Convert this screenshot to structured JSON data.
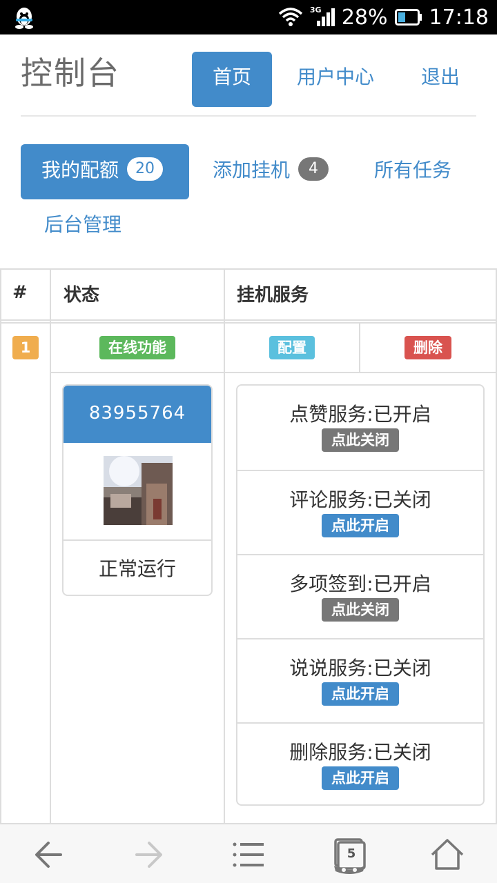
{
  "status_bar": {
    "network": "3G",
    "battery": "28%",
    "time": "17:18",
    "icons": [
      "qq-penguin-icon",
      "wifi-icon",
      "cellular-signal-icon",
      "battery-icon"
    ]
  },
  "header": {
    "brand": "控制台",
    "nav": [
      {
        "label": "首页",
        "active": true
      },
      {
        "label": "用户中心",
        "active": false
      },
      {
        "label": "退出",
        "active": false
      }
    ]
  },
  "tabs": [
    {
      "label": "我的配额",
      "badge": "20",
      "active": true
    },
    {
      "label": "添加挂机",
      "badge": "4",
      "active": false
    },
    {
      "label": "所有任务",
      "active": false
    },
    {
      "label": "后台管理",
      "active": false
    }
  ],
  "table": {
    "headers": [
      "#",
      "状态",
      "挂机服务"
    ],
    "rows": [
      {
        "index": "1",
        "status_label": "在线功能",
        "config_label": "配置",
        "delete_label": "删除",
        "account": {
          "qq": "83955764",
          "state": "正常运行"
        },
        "services": [
          {
            "title": "点赞服务:已开启",
            "action": "点此关闭",
            "enabled": true
          },
          {
            "title": "评论服务:已关闭",
            "action": "点此开启",
            "enabled": false
          },
          {
            "title": "多项签到:已开启",
            "action": "点此关闭",
            "enabled": true
          },
          {
            "title": "说说服务:已关闭",
            "action": "点此开启",
            "enabled": false
          },
          {
            "title": "删除服务:已关闭",
            "action": "点此开启",
            "enabled": false
          }
        ]
      }
    ]
  },
  "bottom_bar": {
    "tab_count": "5",
    "icons": [
      "back-arrow-icon",
      "forward-arrow-icon",
      "menu-icon",
      "tabs-icon",
      "home-icon"
    ]
  },
  "colors": {
    "primary": "#428bca",
    "success": "#5cb85c",
    "info": "#5bc0de",
    "danger": "#d9534f",
    "warning": "#f0ad4e",
    "muted": "#777777"
  }
}
